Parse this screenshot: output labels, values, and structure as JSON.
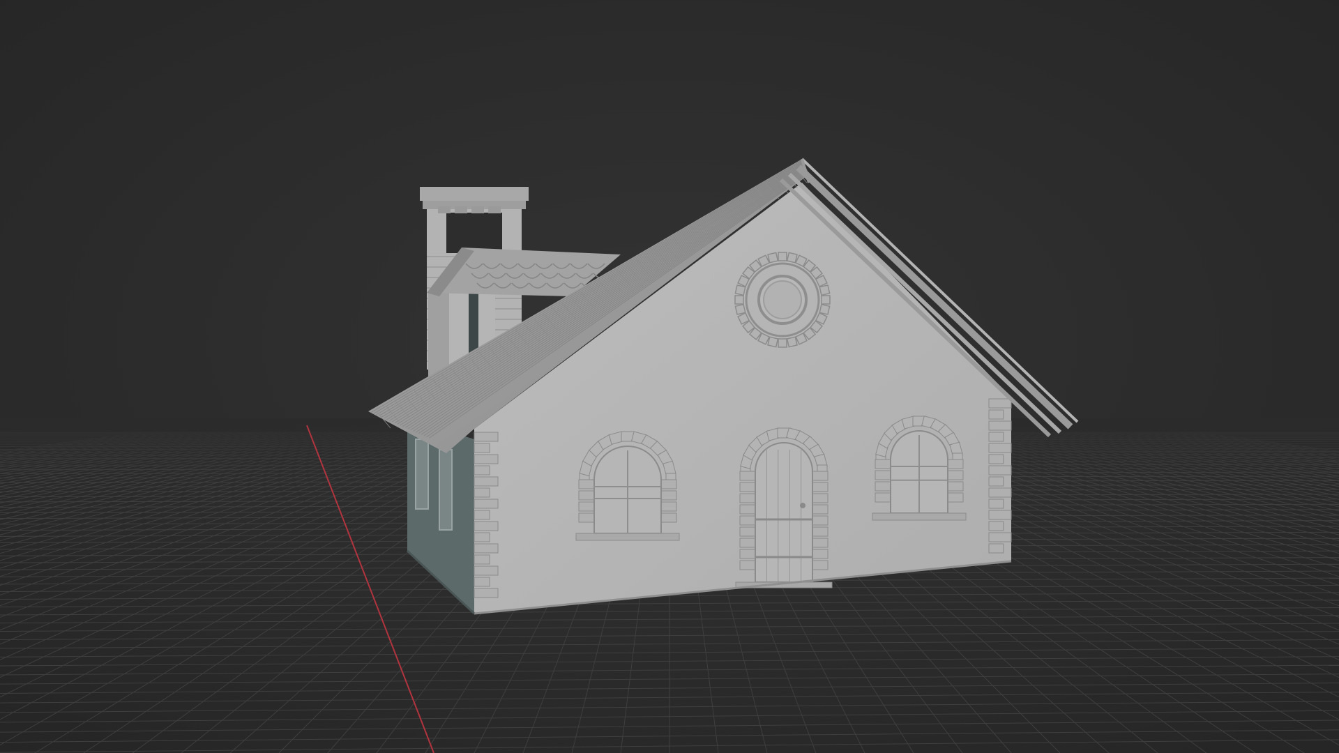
{
  "viewport": {
    "background_color": "#2b2b2b",
    "grid_line_color": "#3f3f3f",
    "x_axis_color": "#b2343f",
    "show_grid": true
  },
  "scene": {
    "object": "house",
    "wall_color": "#b8b8b8",
    "wall_shadow_color": "#5c6a6a",
    "roof_color": "#9d9d9d",
    "trim_color": "#a9a9a9",
    "brick_line_color": "#8a8a8a",
    "chimney_opening_color": "#2d2d2d",
    "window_count": 3,
    "door_count": 1,
    "round_window": "oculus-with-gear-frame"
  }
}
